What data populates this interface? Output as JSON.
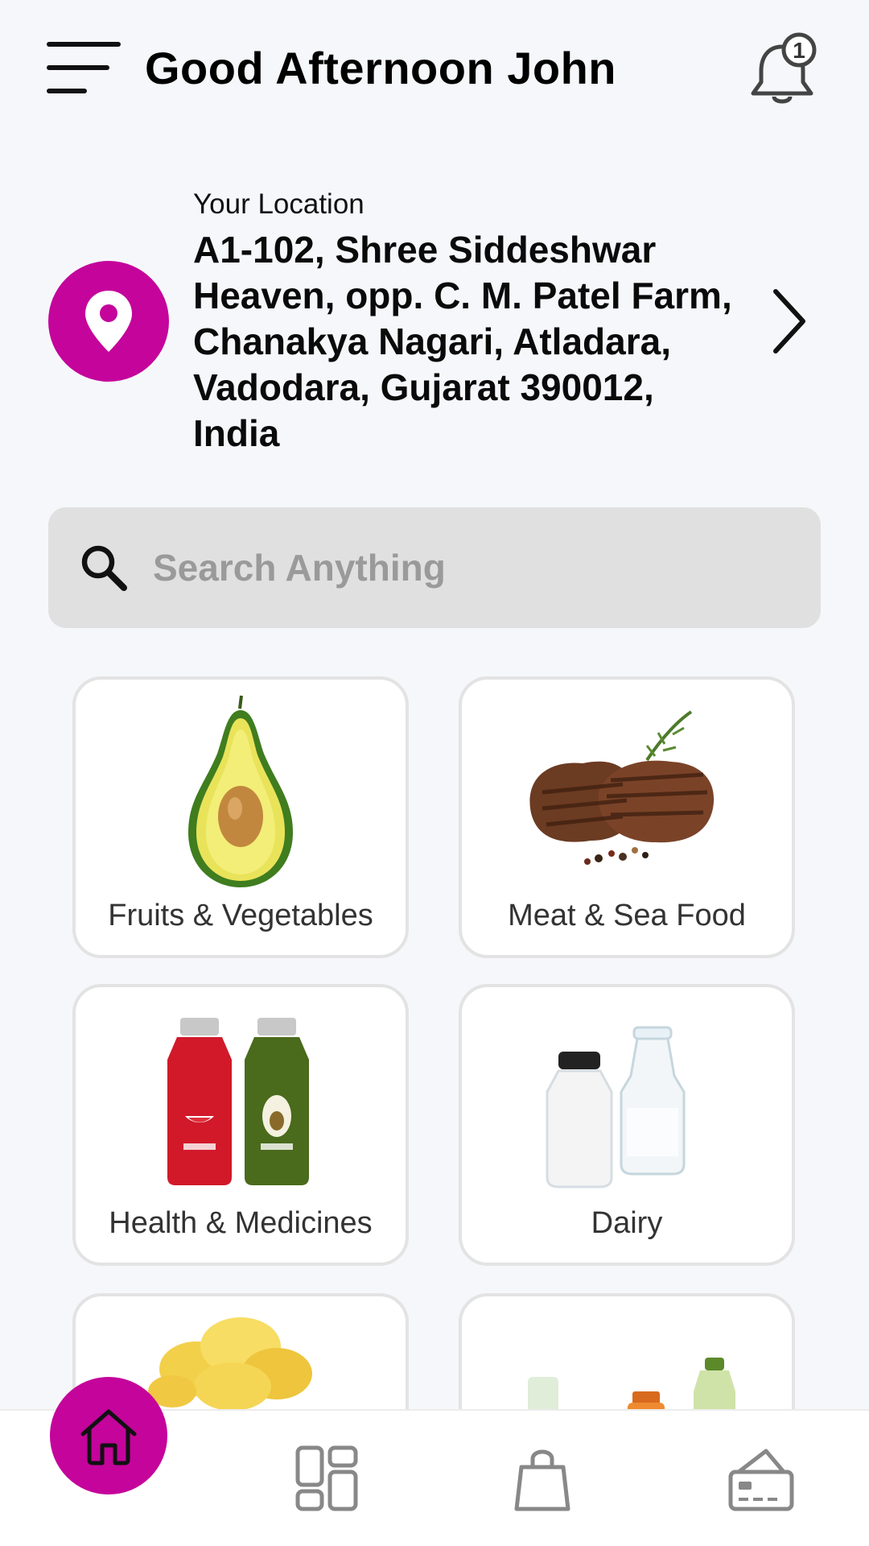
{
  "header": {
    "greeting": "Good Afternoon John",
    "notification_count": "1",
    "icons": {
      "menu": "hamburger-menu-icon",
      "notifications": "bell-icon"
    }
  },
  "location": {
    "label": "Your Location",
    "address": "A1-102, Shree Siddeshwar Heaven, opp. C. M. Patel Farm, Chanakya Nagari, Atladara, Vadodara, Gujarat 390012, India",
    "icons": {
      "pin": "location-pin-icon",
      "next": "chevron-right-icon"
    }
  },
  "search": {
    "placeholder": "Search Anything",
    "value": "",
    "icon": "search-icon"
  },
  "categories": [
    {
      "label": "Fruits & Vegetables",
      "image": "avocado"
    },
    {
      "label": "Meat & Sea Food",
      "image": "grilled-steak"
    },
    {
      "label": "Health & Medicines",
      "image": "juice-bottles"
    },
    {
      "label": "Dairy",
      "image": "milk-bottles"
    },
    {
      "label": "",
      "image": "potato-chips"
    },
    {
      "label": "",
      "image": "beverage-bottles"
    }
  ],
  "bottom_nav": {
    "items": [
      {
        "name": "home",
        "icon": "home-icon",
        "active": true
      },
      {
        "name": "dashboard",
        "icon": "dashboard-icon",
        "active": false
      },
      {
        "name": "orders",
        "icon": "shopping-bag-icon",
        "active": false
      },
      {
        "name": "payments",
        "icon": "wallet-card-icon",
        "active": false
      }
    ]
  },
  "colors": {
    "accent": "#c4049b",
    "background": "#f6f7fb",
    "search_bg": "#e0e0e0",
    "card_border": "#e3e3e3"
  }
}
